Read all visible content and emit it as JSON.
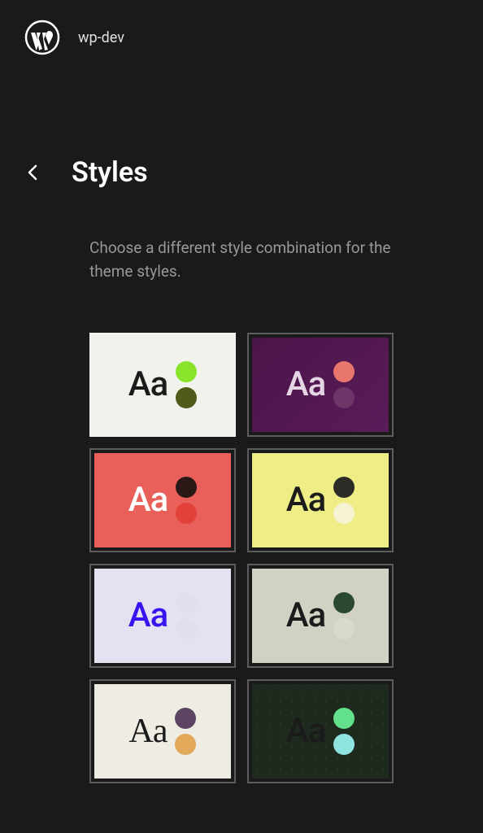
{
  "header": {
    "site_name": "wp-dev"
  },
  "page": {
    "title": "Styles",
    "description": "Choose a different style combination for the theme styles."
  },
  "styles": [
    {
      "name": "style-light-green",
      "bg": "#f1f2eb",
      "text_color": "#1b1b1b",
      "dot1": "#89e429",
      "dot2": "#4e5a1a",
      "aa": "Aa",
      "bordered": false,
      "serif": false
    },
    {
      "name": "style-purple",
      "bg": "linear-gradient(135deg, #4a1548 0%, #5b1b5a 100%)",
      "text_color": "#e6d5e5",
      "dot1": "#e8766d",
      "dot2": "#6e3568",
      "aa": "Aa",
      "bordered": true,
      "serif": false
    },
    {
      "name": "style-red",
      "bg": "#e86059",
      "text_color": "#ffffff",
      "dot1": "#2a1817",
      "dot2": "#e14138",
      "aa": "Aa",
      "bordered": true,
      "serif": false
    },
    {
      "name": "style-yellow",
      "bg": "#eeed86",
      "text_color": "#1b1b1b",
      "dot1": "#2b2b28",
      "dot2": "#f5f3d1",
      "aa": "Aa",
      "bordered": true,
      "serif": false
    },
    {
      "name": "style-lavender",
      "bg": "#e3e2f2",
      "text_color": "#3615f0",
      "dot1": "#e0dff0",
      "dot2": "#e0dff0",
      "aa": "Aa",
      "bordered": true,
      "serif": false
    },
    {
      "name": "style-sage",
      "bg": "#d1d2c3",
      "text_color": "#1b1b1b",
      "dot1": "#2a4930",
      "dot2": "#d9dacb",
      "aa": "Aa",
      "bordered": true,
      "serif": false
    },
    {
      "name": "style-cream-serif",
      "bg": "#eeece3",
      "text_color": "#1b1b1b",
      "dot1": "#5b4562",
      "dot2": "#e2a95b",
      "aa": "Aa",
      "bordered": true,
      "serif": true
    },
    {
      "name": "style-dark-dotted",
      "bg": "radial-gradient(circle, #2e3a2e 1px, transparent 1px), #1f2a1f",
      "bg_size": "14px 14px",
      "text_color": "#1b1b1b",
      "dot1": "#63e08b",
      "dot2": "#8fe3e0",
      "aa": "Aa",
      "bordered": true,
      "serif": false
    }
  ]
}
